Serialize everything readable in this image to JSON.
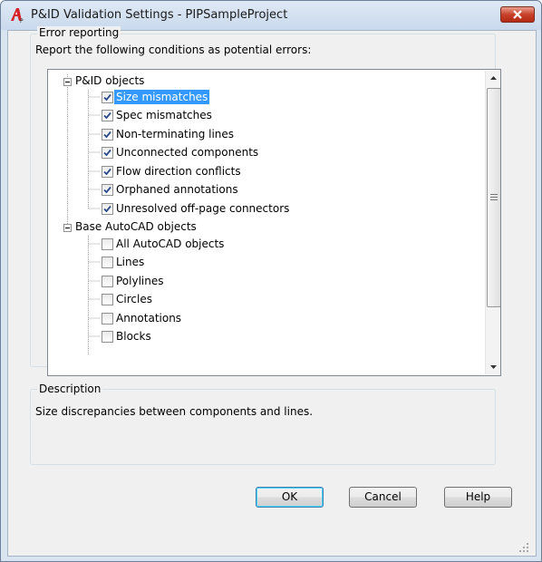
{
  "dialog": {
    "title": "P&ID Validation Settings - PIPSampleProject"
  },
  "error_reporting": {
    "legend": "Error reporting",
    "instruction": "Report the following conditions as potential errors:",
    "groups": [
      {
        "label": "P&ID objects",
        "expanded": true,
        "items": [
          {
            "label": "Size mismatches",
            "checked": true,
            "selected": true
          },
          {
            "label": "Spec mismatches",
            "checked": true
          },
          {
            "label": "Non-terminating lines",
            "checked": true
          },
          {
            "label": "Unconnected components",
            "checked": true
          },
          {
            "label": "Flow direction conflicts",
            "checked": true
          },
          {
            "label": "Orphaned annotations",
            "checked": true
          },
          {
            "label": "Unresolved off-page connectors",
            "checked": true
          }
        ]
      },
      {
        "label": "Base AutoCAD objects",
        "expanded": true,
        "items": [
          {
            "label": "All AutoCAD objects",
            "checked": false
          },
          {
            "label": "Lines",
            "checked": false
          },
          {
            "label": "Polylines",
            "checked": false
          },
          {
            "label": "Circles",
            "checked": false
          },
          {
            "label": "Annotations",
            "checked": false
          },
          {
            "label": "Blocks",
            "checked": false
          }
        ]
      }
    ]
  },
  "description": {
    "legend": "Description",
    "text": "Size discrepancies between components and lines."
  },
  "buttons": {
    "ok": "OK",
    "cancel": "Cancel",
    "help": "Help"
  },
  "colors": {
    "selection": "#3399ff",
    "close_button": "#c8412a",
    "app_icon": "#d4242a"
  }
}
